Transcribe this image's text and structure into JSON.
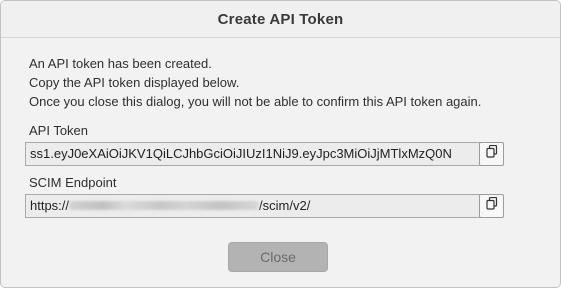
{
  "dialog": {
    "title": "Create API Token",
    "message_lines": [
      "An API token has been created.",
      "Copy the API token displayed below.",
      "Once you close this dialog, you will not be able to confirm this API token again."
    ],
    "api_token": {
      "label": "API Token",
      "value": "ss1.eyJ0eXAiOiJKV1QiLCJhbGciOiJIUzI1NiJ9.eyJpc3MiOiJjMTlxMzQ0N",
      "copy_icon": "copy-icon"
    },
    "scim_endpoint": {
      "label": "SCIM Endpoint",
      "value_prefix": "https://",
      "value_suffix": "/scim/v2/",
      "copy_icon": "copy-icon"
    },
    "close_label": "Close"
  }
}
